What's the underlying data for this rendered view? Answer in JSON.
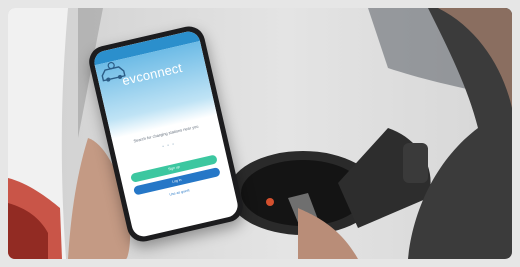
{
  "app": {
    "logo_text": "evconnect",
    "message": "Search for charging stations near you",
    "signup_label": "Sign up",
    "login_label": "Log in",
    "guest_label": "Use as guest"
  },
  "colors": {
    "brand_blue": "#2b8fcc",
    "green_button": "#3cc7a0",
    "blue_button": "#2577c7"
  }
}
